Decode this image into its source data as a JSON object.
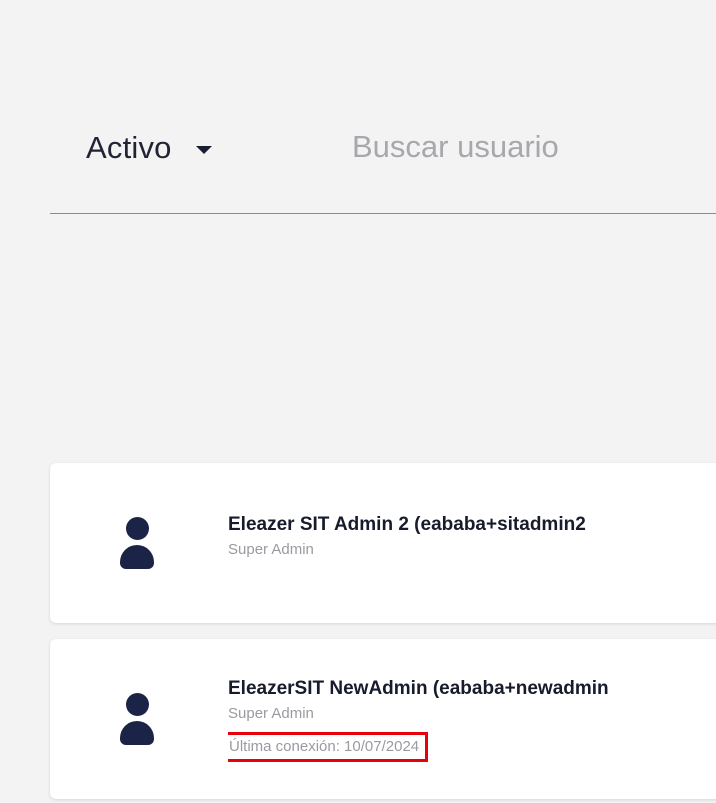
{
  "filter": {
    "status_value": "Activo",
    "search_placeholder": "Buscar usuario"
  },
  "users": [
    {
      "name": "Eleazer SIT Admin 2 (eababa+sitadmin2",
      "role": "Super Admin"
    },
    {
      "name": "EleazerSIT NewAdmin (eababa+newadmin",
      "role": "Super Admin",
      "last_login": "Última conexión: 10/07/2024"
    }
  ],
  "colors": {
    "background": "#f3f3f4",
    "avatar": "#1b2446",
    "highlight_border": "#e8000b",
    "muted_text": "#9a9aa1"
  },
  "icons": {
    "status_caret": "chevron-down-icon",
    "user_avatar": "user-icon"
  }
}
